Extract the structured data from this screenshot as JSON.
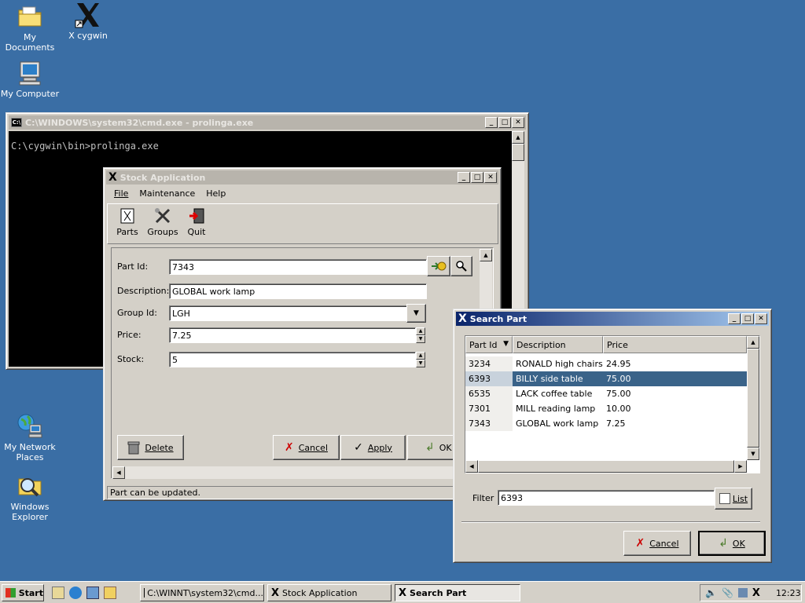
{
  "desktop": {
    "icons": [
      {
        "label": "My Documents"
      },
      {
        "label": "X cygwin"
      },
      {
        "label": "My Computer"
      },
      {
        "label": "My Network Places"
      },
      {
        "label": "Windows Explorer"
      }
    ]
  },
  "cmd": {
    "title": "C:\\WINDOWS\\system32\\cmd.exe - prolinga.exe",
    "prompt": "C:\\cygwin\\bin>prolinga.exe"
  },
  "stock": {
    "title": "Stock Application",
    "menu": [
      "File",
      "Maintenance",
      "Help"
    ],
    "toolbar": [
      "Parts",
      "Groups",
      "Quit"
    ],
    "form": {
      "part_id_label": "Part Id:",
      "part_id_value": "7343",
      "description_label": "Description:",
      "description_value": "GLOBAL work lamp",
      "group_label": "Group Id:",
      "group_value": "LGH",
      "price_label": "Price:",
      "price_value": "7.25",
      "stock_label": "Stock:",
      "stock_value": "5"
    },
    "buttons": {
      "delete": "Delete",
      "cancel": "Cancel",
      "apply": "Apply",
      "ok": "OK"
    },
    "status": "Part can be updated."
  },
  "search": {
    "title": "Search Part",
    "columns": [
      "Part Id",
      "Description",
      "Price"
    ],
    "rows": [
      {
        "id": "3234",
        "desc": "RONALD high chairs",
        "price": "24.95"
      },
      {
        "id": "6393",
        "desc": "BILLY side table",
        "price": "75.00"
      },
      {
        "id": "6535",
        "desc": "LACK coffee table",
        "price": "75.00"
      },
      {
        "id": "7301",
        "desc": "MILL reading lamp",
        "price": "10.00"
      },
      {
        "id": "7343",
        "desc": "GLOBAL work lamp",
        "price": "7.25"
      }
    ],
    "selected_row_index": 1,
    "filter_label": "Filter",
    "filter_value": "6393",
    "list_button": "List",
    "cancel_button": "Cancel",
    "ok_button": "OK"
  },
  "taskbar": {
    "start": "Start",
    "tasks": [
      "C:\\WINNT\\system32\\cmd...",
      "Stock Application",
      "Search Part"
    ],
    "clock": "12:23"
  },
  "colors": {
    "desktop": "#3a6ea5",
    "selection": "#3a6389",
    "active_title": "#0a246a"
  }
}
